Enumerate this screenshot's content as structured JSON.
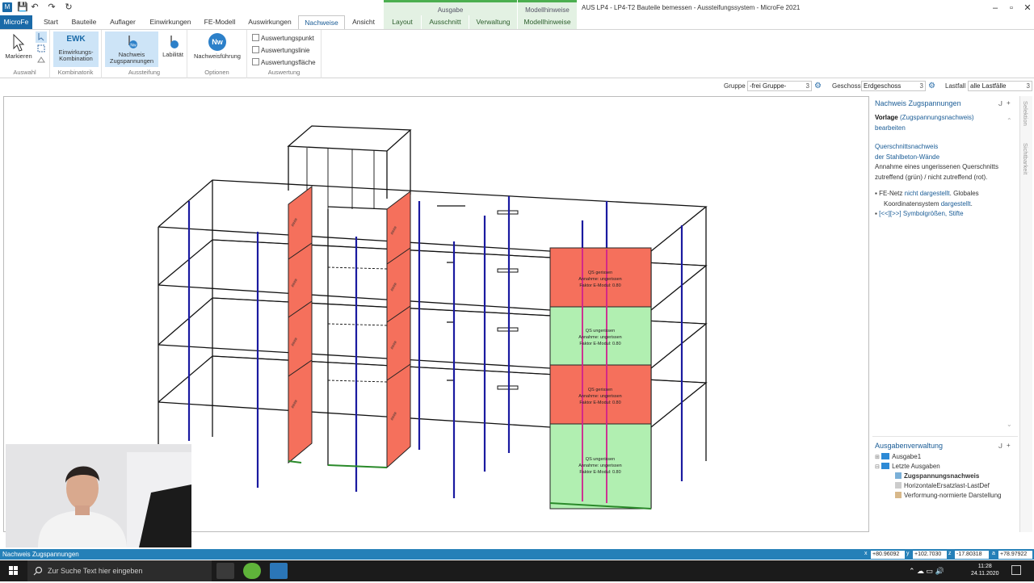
{
  "titlebar": {
    "app_logo": "M",
    "title": "AUS LP4 - LP4-T2 Bauteile bemessen - Aussteifungssystem - MicroFe 2021",
    "context_groups": [
      "Ausgabe",
      "Modellhinweise"
    ]
  },
  "tabs": [
    "MicroFe",
    "Start",
    "Bauteile",
    "Auflager",
    "Einwirkungen",
    "FE-Modell",
    "Auswirkungen",
    "Nachweise",
    "Ansicht",
    "Layout",
    "Ausschnitt",
    "Verwaltung",
    "Modellhinweise"
  ],
  "ribbon": {
    "groups": {
      "auswahl": "Auswahl",
      "kombinatorik": "Kombinatorik",
      "aussteifung": "Aussteifung",
      "optionen": "Optionen",
      "auswertung": "Auswertung"
    },
    "buttons": {
      "markieren": "Markieren",
      "ewk_icon_text": "EWK",
      "ewk_line1": "Einwirkungs-",
      "ewk_line2": "Kombination",
      "nachweis_line1": "Nachweis",
      "nachweis_line2": "Zugspannungen",
      "labilitaet": "Labilität",
      "nw_icon_text": "Nw",
      "nachweisfuehrung": "Nachweisführung",
      "auswertungspunkt": "Auswertungspunkt",
      "auswertungslinie": "Auswertungslinie",
      "auswertungsflaeche": "Auswertungsfläche"
    }
  },
  "filter": {
    "gruppe_label": "Gruppe",
    "gruppe_value": "-frei Gruppe-",
    "geschoss_label": "Geschoss",
    "geschoss_value": "Erdgeschoss",
    "lastfall_label": "Lastfall",
    "lastfall_value": "alle Lastfälle",
    "dropdown_num": "3"
  },
  "model": {
    "panel_line1_red": "QS gerissen",
    "panel_line1_green": "QS ungerissen",
    "panel_line2": "Annahme: ungerissen",
    "panel_line3": "Faktor E-Modul: 0.80"
  },
  "right_panel": {
    "title": "Nachweis Zugspannungen",
    "pin": "ᒍ",
    "plus": "+",
    "vorlage_bold": "Vorlage",
    "vorlage_link": "(Zugspannungsnachweis)",
    "bearbeiten": "bearbeiten",
    "qs_line1": "Querschnittsnachweis",
    "qs_line2": "der Stahlbeton-Wände",
    "annahme_line1": "Annahme eines ungerissenen Querschnitts",
    "annahme_line2": "zutreffend (grün) / nicht zutreffend (rot).",
    "bullet1_a": "FE-Netz ",
    "bullet1_b": "nicht dargestellt",
    "bullet1_c": ". Globales",
    "bullet1_d": "Koordinatensystem ",
    "bullet1_e": "dargestellt",
    "bullet1_f": ".",
    "bullet2_link": "[<<][>>] Symbolgrößen, Stifte",
    "side_tab1": "Selektion",
    "side_tab2": "Sichtbarkeit",
    "ausgaben_title": "Ausgabenverwaltung",
    "tree": [
      "Ausgabe1",
      "Letzte Ausgaben",
      "Zugspannungsnachweis",
      "HorizontaleErsatzlast-LastDef",
      "Verformung-normierte Darstellung"
    ]
  },
  "statusbar": {
    "text": "Nachweis Zugspannungen",
    "coords": [
      {
        "label": "x",
        "value": "+80.96092"
      },
      {
        "label": "y",
        "value": "+102.7030"
      },
      {
        "label": "z",
        "value": "-17.80318"
      },
      {
        "label": "a",
        "value": "+78.97922"
      }
    ]
  },
  "taskbar": {
    "search_placeholder": "Zur Suche Text hier eingeben",
    "time": "11:28",
    "date": "24.11.2020"
  },
  "colors": {
    "accent": "#1a6aa8",
    "panel_red": "#f5705c",
    "panel_green": "#b1efb1",
    "column_blue": "#1a1aa0",
    "magenta_line": "#d0208e"
  }
}
